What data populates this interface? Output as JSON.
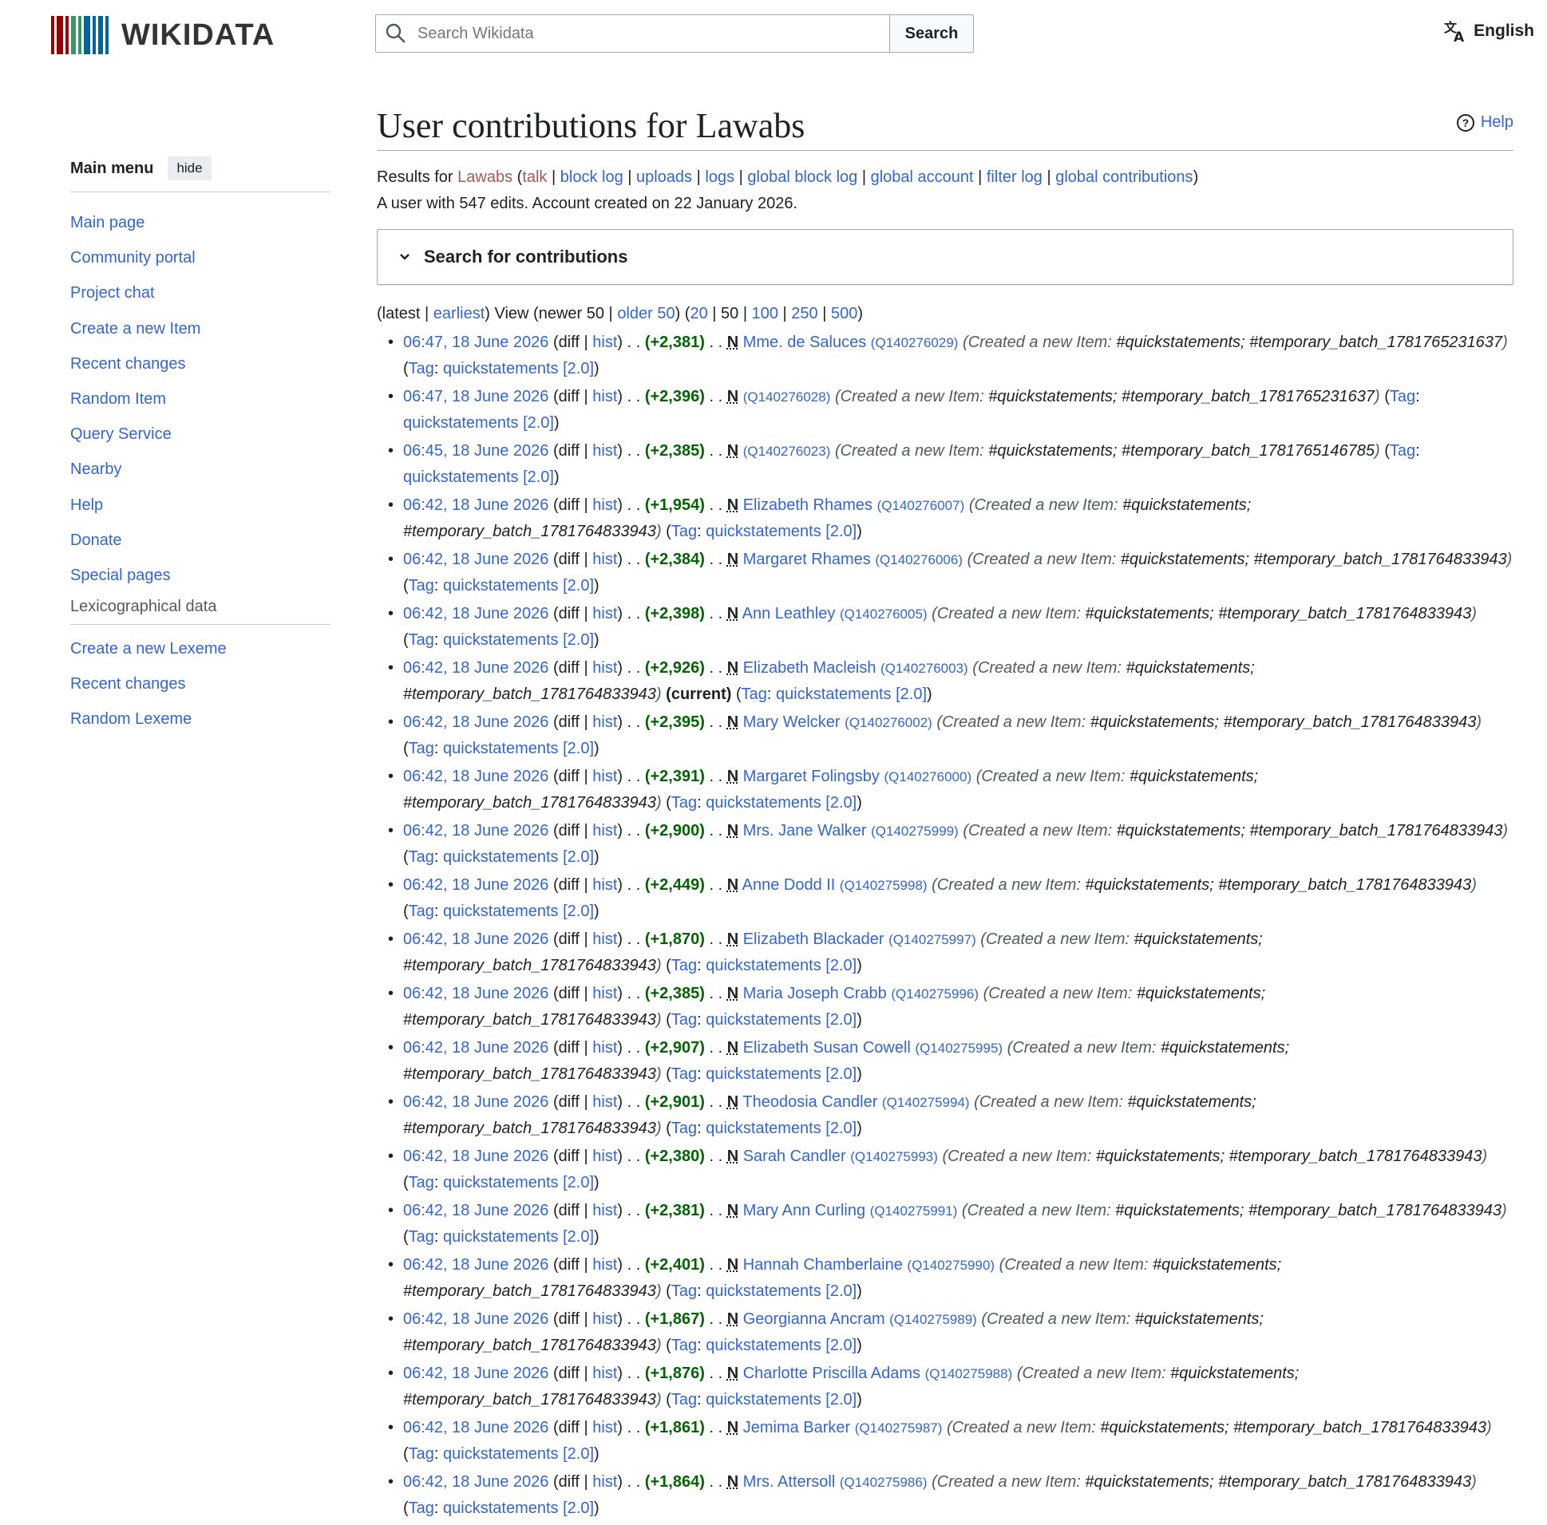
{
  "header": {
    "wordmark": "WIKIDATA",
    "search_placeholder": "Search Wikidata",
    "search_button": "Search",
    "language": "English"
  },
  "sidebar": {
    "title": "Main menu",
    "hide": "hide",
    "items": [
      "Main page",
      "Community portal",
      "Project chat",
      "Create a new Item",
      "Recent changes",
      "Random Item",
      "Query Service",
      "Nearby",
      "Help",
      "Donate",
      "Special pages"
    ],
    "section2_title": "Lexicographical data",
    "section2_items": [
      "Create a new Lexeme",
      "Recent changes",
      "Random Lexeme"
    ]
  },
  "page": {
    "title": "User contributions for Lawabs",
    "help": "Help",
    "results_prefix": "Results for",
    "user": "Lawabs",
    "tool_links": [
      "talk",
      "block log",
      "uploads",
      "logs",
      "global block log",
      "global account",
      "filter log",
      "global contributions"
    ],
    "summary": "A user with 547 edits. Account created on 22 January 2026.",
    "search_box_title": "Search for contributions"
  },
  "pager": {
    "latest": "latest",
    "earliest": "earliest",
    "view": "View",
    "newer": "newer 50",
    "older": "older 50",
    "limits": [
      "20",
      "50",
      "100",
      "250",
      "500"
    ]
  },
  "labels": {
    "diff": "diff",
    "hist": "hist",
    "new_flag": "N",
    "comment_prefix": "Created a new Item:",
    "tag_prefix": "Tag",
    "tag": "quickstatements [2.0]",
    "current": "current"
  },
  "contributions": [
    {
      "time": "06:47, 18 June 2026",
      "size": "+2,381",
      "label": "Mme. de Saluces",
      "qid": "Q140276029",
      "hashtag": "#quickstatements;",
      "batch": "#temporary_batch_1781765231637",
      "current": false
    },
    {
      "time": "06:47, 18 June 2026",
      "size": "+2,396",
      "label": "",
      "qid": "Q140276028",
      "hashtag": "#quickstatements;",
      "batch": "#temporary_batch_1781765231637",
      "current": false
    },
    {
      "time": "06:45, 18 June 2026",
      "size": "+2,385",
      "label": "",
      "qid": "Q140276023",
      "hashtag": "#quickstatements;",
      "batch": "#temporary_batch_1781765146785",
      "current": false
    },
    {
      "time": "06:42, 18 June 2026",
      "size": "+1,954",
      "label": "Elizabeth Rhames",
      "qid": "Q140276007",
      "hashtag": "#quickstatements;",
      "batch": "#temporary_batch_1781764833943",
      "current": false
    },
    {
      "time": "06:42, 18 June 2026",
      "size": "+2,384",
      "label": "Margaret Rhames",
      "qid": "Q140276006",
      "hashtag": "#quickstatements;",
      "batch": "#temporary_batch_1781764833943",
      "current": false
    },
    {
      "time": "06:42, 18 June 2026",
      "size": "+2,398",
      "label": "Ann Leathley",
      "qid": "Q140276005",
      "hashtag": "#quickstatements;",
      "batch": "#temporary_batch_1781764833943",
      "current": false
    },
    {
      "time": "06:42, 18 June 2026",
      "size": "+2,926",
      "label": "Elizabeth Macleish",
      "qid": "Q140276003",
      "hashtag": "#quickstatements;",
      "batch": "#temporary_batch_1781764833943",
      "current": true
    },
    {
      "time": "06:42, 18 June 2026",
      "size": "+2,395",
      "label": "Mary Welcker",
      "qid": "Q140276002",
      "hashtag": "#quickstatements;",
      "batch": "#temporary_batch_1781764833943",
      "current": false
    },
    {
      "time": "06:42, 18 June 2026",
      "size": "+2,391",
      "label": "Margaret Folingsby",
      "qid": "Q140276000",
      "hashtag": "#quickstatements;",
      "batch": "#temporary_batch_1781764833943",
      "current": false
    },
    {
      "time": "06:42, 18 June 2026",
      "size": "+2,900",
      "label": "Mrs. Jane Walker",
      "qid": "Q140275999",
      "hashtag": "#quickstatements;",
      "batch": "#temporary_batch_1781764833943",
      "current": false
    },
    {
      "time": "06:42, 18 June 2026",
      "size": "+2,449",
      "label": "Anne Dodd II",
      "qid": "Q140275998",
      "hashtag": "#quickstatements;",
      "batch": "#temporary_batch_1781764833943",
      "current": false
    },
    {
      "time": "06:42, 18 June 2026",
      "size": "+1,870",
      "label": "Elizabeth Blackader",
      "qid": "Q140275997",
      "hashtag": "#quickstatements;",
      "batch": "#temporary_batch_1781764833943",
      "current": false
    },
    {
      "time": "06:42, 18 June 2026",
      "size": "+2,385",
      "label": "Maria Joseph Crabb",
      "qid": "Q140275996",
      "hashtag": "#quickstatements;",
      "batch": "#temporary_batch_1781764833943",
      "current": false
    },
    {
      "time": "06:42, 18 June 2026",
      "size": "+2,907",
      "label": "Elizabeth Susan Cowell",
      "qid": "Q140275995",
      "hashtag": "#quickstatements;",
      "batch": "#temporary_batch_1781764833943",
      "current": false
    },
    {
      "time": "06:42, 18 June 2026",
      "size": "+2,901",
      "label": "Theodosia Candler",
      "qid": "Q140275994",
      "hashtag": "#quickstatements;",
      "batch": "#temporary_batch_1781764833943",
      "current": false
    },
    {
      "time": "06:42, 18 June 2026",
      "size": "+2,380",
      "label": "Sarah Candler",
      "qid": "Q140275993",
      "hashtag": "#quickstatements;",
      "batch": "#temporary_batch_1781764833943",
      "current": false
    },
    {
      "time": "06:42, 18 June 2026",
      "size": "+2,381",
      "label": "Mary Ann Curling",
      "qid": "Q140275991",
      "hashtag": "#quickstatements;",
      "batch": "#temporary_batch_1781764833943",
      "current": false
    },
    {
      "time": "06:42, 18 June 2026",
      "size": "+2,401",
      "label": "Hannah Chamberlaine",
      "qid": "Q140275990",
      "hashtag": "#quickstatements;",
      "batch": "#temporary_batch_1781764833943",
      "current": false
    },
    {
      "time": "06:42, 18 June 2026",
      "size": "+1,867",
      "label": "Georgianna Ancram",
      "qid": "Q140275989",
      "hashtag": "#quickstatements;",
      "batch": "#temporary_batch_1781764833943",
      "current": false
    },
    {
      "time": "06:42, 18 June 2026",
      "size": "+1,876",
      "label": "Charlotte Priscilla Adams",
      "qid": "Q140275988",
      "hashtag": "#quickstatements;",
      "batch": "#temporary_batch_1781764833943",
      "current": false
    },
    {
      "time": "06:42, 18 June 2026",
      "size": "+1,861",
      "label": "Jemima Barker",
      "qid": "Q140275987",
      "hashtag": "#quickstatements;",
      "batch": "#temporary_batch_1781764833943",
      "current": false
    },
    {
      "time": "06:42, 18 June 2026",
      "size": "+1,864",
      "label": "Mrs. Attersoll",
      "qid": "Q140275986",
      "hashtag": "#quickstatements;",
      "batch": "#temporary_batch_1781764833943",
      "current": false
    }
  ],
  "colors": {
    "link": "#3366cc",
    "redlink": "#a55858",
    "positive": "#006400",
    "logo_red": "#990000",
    "logo_green": "#339966",
    "logo_blue": "#006699"
  }
}
